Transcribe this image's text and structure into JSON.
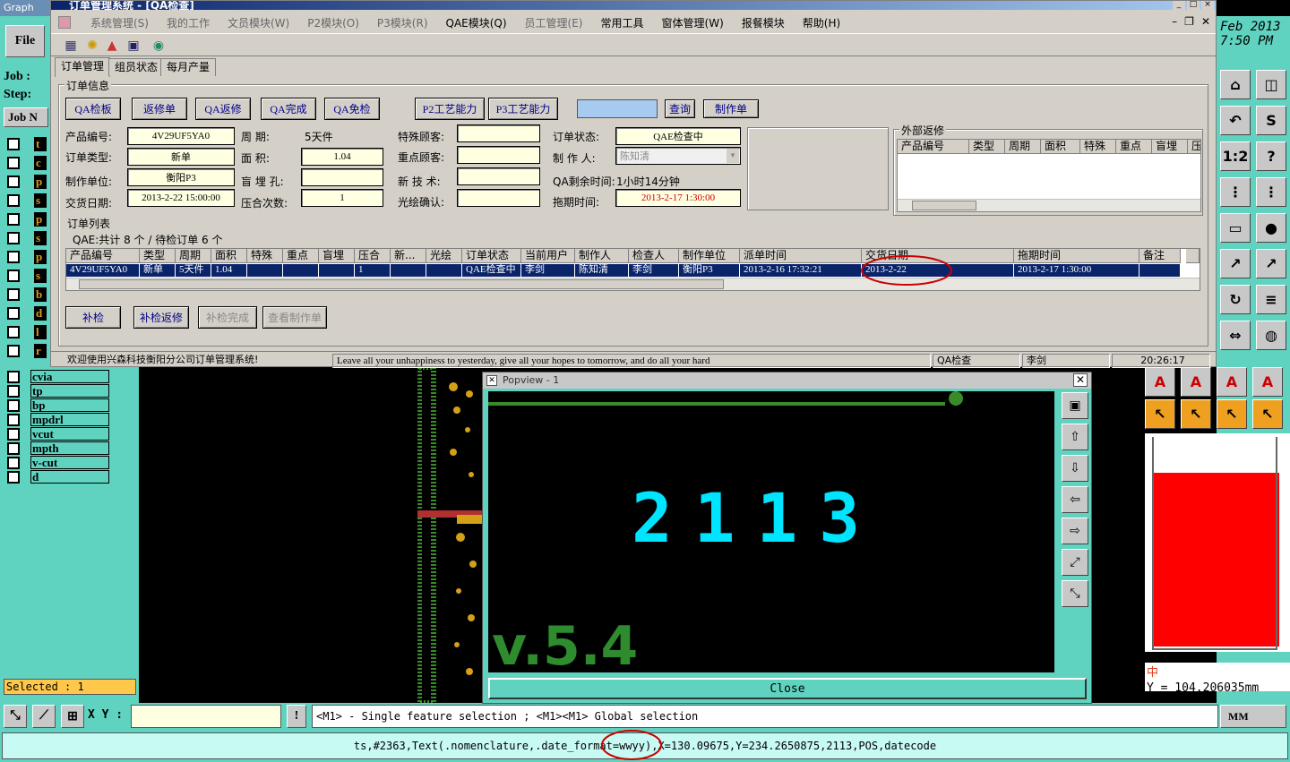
{
  "genesis": {
    "title_fragment": "Graph",
    "file_menu": "File",
    "job_label": "Job :",
    "step_label": "Step:",
    "job_tab": "Job N",
    "layers_top": [
      "t",
      "c",
      "p",
      "s",
      "p",
      "s",
      "p",
      "s",
      "b",
      "d",
      "l",
      "r"
    ],
    "layers": [
      "cvia",
      "tp",
      "bp",
      "mpdrl",
      "vcut",
      "mpth",
      "v-cut",
      "d"
    ],
    "selected_label": "Selected : 1",
    "clock_date": "Feb 2013",
    "clock_time": "7:50 PM",
    "xy_label": "X Y :",
    "xy_value": "",
    "hint": "<M1> - Single feature selection ; <M1><M1> Global selection",
    "units": "MM",
    "info_line": "ts,#2363,Text(.nomenclature,.date_format=wwyy),X=130.09675,Y=234.2650875,2113,POS,datecode",
    "y_readout": "Y = 104.206035mm",
    "ime_label": "中"
  },
  "app": {
    "title": "订单管理系统 - [QA检查]",
    "menus": [
      "系统管理(S)",
      "我的工作",
      "文员模块(W)",
      "P2模块(O)",
      "P3模块(R)",
      "QAE模块(Q)",
      "员工管理(E)",
      "常用工具",
      "窗体管理(W)",
      "报餐模块",
      "帮助(H)"
    ],
    "tabs": [
      "订单管理",
      "组员状态",
      "每月产量"
    ],
    "order_info": {
      "group_title": "订单信息",
      "buttons": [
        "QA检板",
        "返修单",
        "QA返修",
        "QA完成",
        "QA免检",
        "P2工艺能力",
        "P3工艺能力",
        "查询",
        "制作单"
      ],
      "search_value": "",
      "fields": {
        "product_no_label": "产品编号:",
        "product_no": "4V29UF5YA0",
        "cycle_label": "周    期:",
        "cycle": "5天件",
        "special_customer_label": "特殊顾客:",
        "special_customer": "",
        "order_status_label": "订单状态:",
        "order_status": "QAE检查中",
        "order_type_label": "订单类型:",
        "order_type": "新单",
        "area_label": "面    积:",
        "area": "1.04",
        "key_customer_label": "重点顾客:",
        "key_customer": "",
        "maker_label": "制 作 人:",
        "maker": "陈知清",
        "unit_label": "制作单位:",
        "unit": "衡阳P3",
        "blind_hole_label": "盲 埋 孔:",
        "blind_hole": "",
        "new_tech_label": "新 技 术:",
        "new_tech": "",
        "qa_remaining_label": "QA剩余时间:",
        "qa_remaining": "1小时14分钟",
        "delivery_label": "交货日期:",
        "delivery": "2013-2-22 15:00:00",
        "press_label": "压合次数:",
        "press": "1",
        "plot_confirm_label": "光绘确认:",
        "plot_confirm": "",
        "delay_label": "拖期时间:",
        "delay": "2013-2-17 1:30:00"
      }
    },
    "external_repair": {
      "group_title": "外部返修",
      "columns": [
        "产品编号",
        "类型",
        "周期",
        "面积",
        "特殊",
        "重点",
        "盲埋",
        "压"
      ]
    },
    "order_list": {
      "group_title": "订单列表",
      "summary": "QAE:共计 8 个 / 待检订单 6 个",
      "columns": [
        "产品编号",
        "类型",
        "周期",
        "面积",
        "特殊",
        "重点",
        "盲埋",
        "压合",
        "新...",
        "光绘",
        "订单状态",
        "当前用户",
        "制作人",
        "检查人",
        "制作单位",
        "派单时间",
        "交货日期",
        "拖期时间",
        "备注"
      ],
      "rows": [
        [
          "4V29UF5YA0",
          "新单",
          "5天件",
          "1.04",
          "",
          "",
          "",
          "1",
          "",
          "",
          "QAE检查中",
          "李剑",
          "陈知清",
          "李剑",
          "衡阳P3",
          "2013-2-16 17:32:21",
          "2013-2-22",
          "2013-2-17 1:30:00",
          ""
        ]
      ]
    },
    "bottom_buttons": [
      "补检",
      "补检返修",
      "补检完成",
      "查看制作单"
    ],
    "status": {
      "welcome": "欢迎使用兴森科技衡阳分公司订单管理系统!",
      "motto": "Leave all your unhappiness to yesterday, give all your hopes to tomorrow, and do all your hard",
      "module": "QA检查",
      "user": "李剑",
      "time": "20:26:17"
    }
  },
  "popview": {
    "title": "Popview - 1",
    "close_label": "Close",
    "canvas_digits": "2113",
    "canvas_text": "v.5.4",
    "colors": {
      "digits": "#00e5ff",
      "text": "#2e8b2e",
      "pcb": "#d4a017",
      "panel": "#ff0000"
    }
  }
}
